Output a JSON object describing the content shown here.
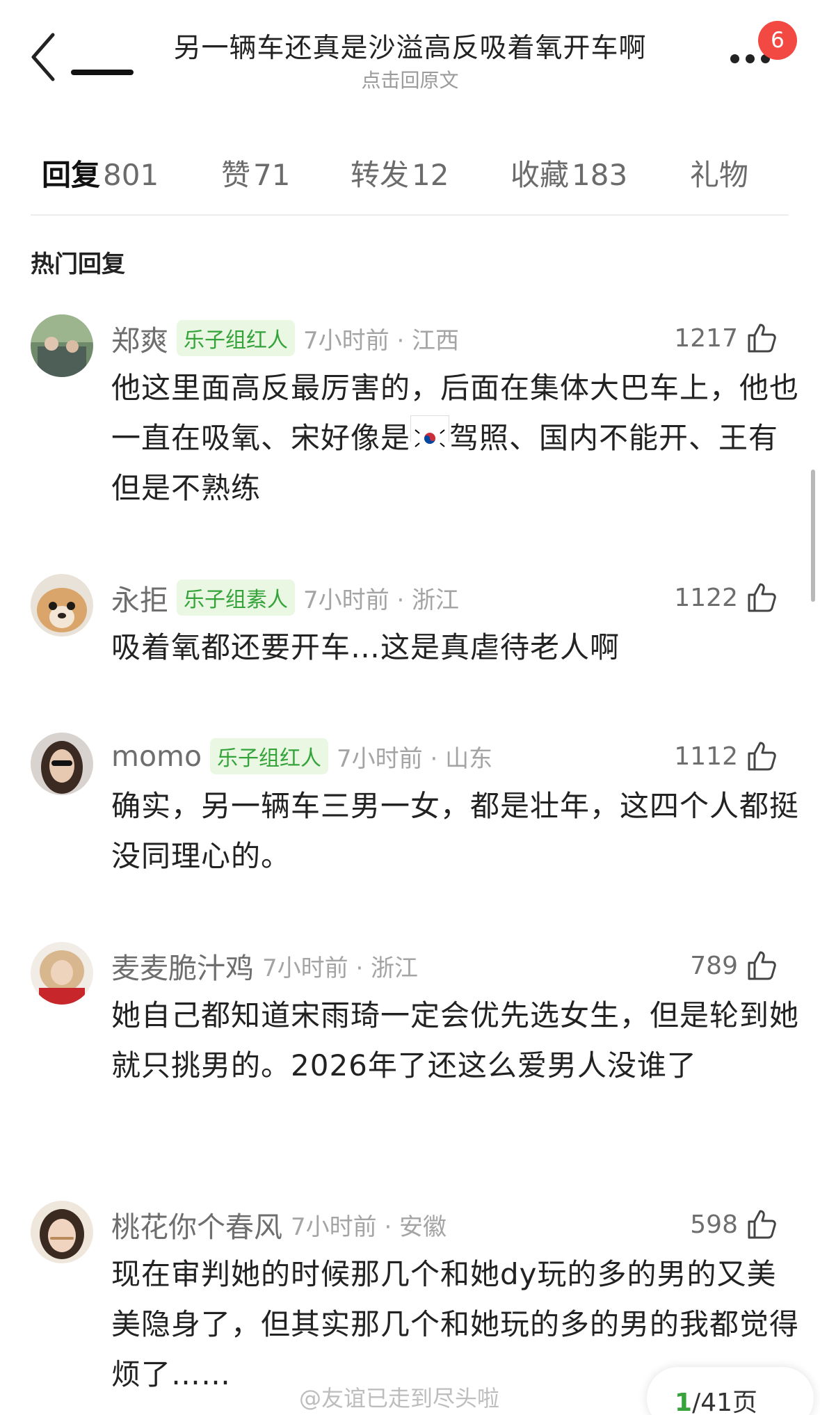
{
  "header": {
    "title": "另一辆车还真是沙溢高反吸着氧开车啊",
    "subtitle": "点击回原文",
    "badge_count": "6"
  },
  "tabs": [
    {
      "label": "回复",
      "count": "801",
      "active": true
    },
    {
      "label": "赞",
      "count": "71",
      "active": false
    },
    {
      "label": "转发",
      "count": "12",
      "active": false
    },
    {
      "label": "收藏",
      "count": "183",
      "active": false
    },
    {
      "label": "礼物",
      "count": "",
      "active": false
    }
  ],
  "section_title": "热门回复",
  "comments": [
    {
      "username": "郑爽",
      "group_tag": "乐子组红人",
      "time_loc": "7小时前 · 江西",
      "likes": "1217",
      "content_before_flag": "他这里面高反最厉害的，后面在集体大巴车上，他也一直在吸氧、宋好像是",
      "flag": "south-korea-flag",
      "content_after_flag": "驾照、国内不能开、王有但是不熟练"
    },
    {
      "username": "永拒",
      "group_tag": "乐子组素人",
      "time_loc": "7小时前 · 浙江",
      "likes": "1122",
      "content": "吸着氧都还要开车…这是真虐待老人啊"
    },
    {
      "username": "momo",
      "group_tag": "乐子组红人",
      "time_loc": "7小时前 · 山东",
      "likes": "1112",
      "content": "确实，另一辆车三男一女，都是壮年，这四个人都挺没同理心的。"
    },
    {
      "username": "麦麦脆汁鸡",
      "group_tag": "",
      "time_loc": "7小时前 · 浙江",
      "likes": "789",
      "content": "她自己都知道宋雨琦一定会优先选女生，但是轮到她就只挑男的。2026年了还这么爱男人没谁了"
    },
    {
      "username": "桃花你个春风",
      "group_tag": "",
      "time_loc": "7小时前 · 安徽",
      "likes": "598",
      "content": "现在审判她的时候那几个和她dy玩的多的男的又美美隐身了，但其实那几个和她玩的多的男的我都觉得烦了……"
    }
  ],
  "footer": {
    "watermark": "@友谊已走到尽头啦",
    "pager_current": "1",
    "pager_total": "/41页"
  },
  "icons": {
    "back": "chevron-left-icon",
    "more": "more-icon",
    "like": "thumbs-up-icon"
  },
  "colors": {
    "badge": "#f24a43",
    "group_tag_bg": "#eaf7e2",
    "group_tag_text": "#34a33a",
    "meta_text": "#a4a4a4"
  }
}
